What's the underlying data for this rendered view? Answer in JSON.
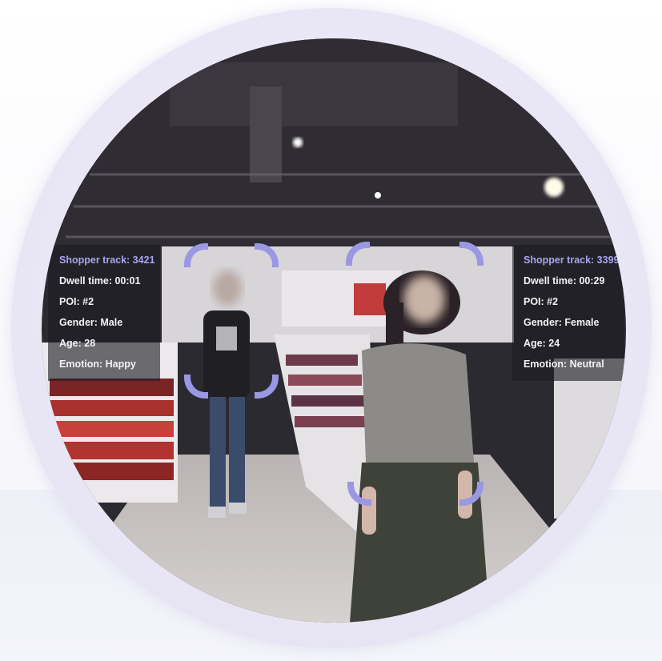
{
  "shopper_left": {
    "track": "Shopper track: 3421",
    "dwell": "Dwell time: 00:01",
    "poi": "POI: #2",
    "gender": "Gender: Male",
    "age": "Age: 28",
    "emotion": "Emotion: Happy"
  },
  "shopper_right": {
    "track": "Shopper track: 3399",
    "dwell": "Dwell time: 00:29",
    "poi": "POI: #2",
    "gender": "Gender: Female",
    "age": "Age: 24",
    "emotion": "Emotion: Neutral"
  },
  "colors": {
    "bracket": "#9b97e3",
    "track_title": "#a9a5ee",
    "card_bg": "#1c1c22"
  }
}
